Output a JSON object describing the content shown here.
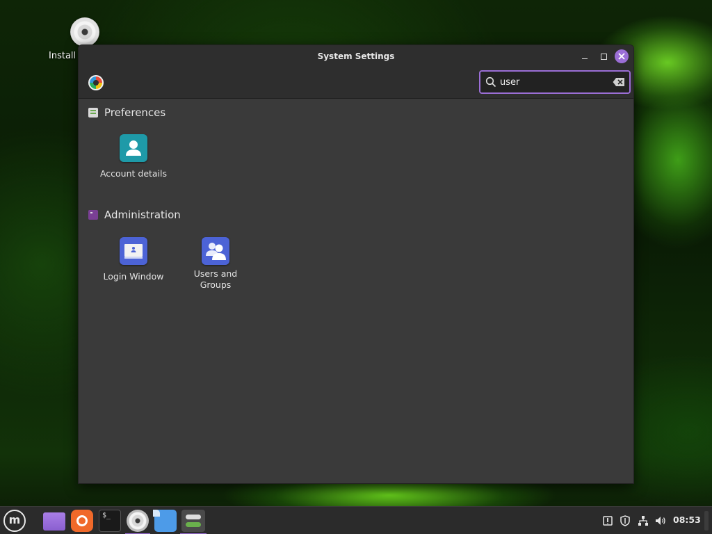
{
  "desktop": {
    "icons": [
      {
        "label": "Install",
        "icon": "disc-icon"
      }
    ]
  },
  "window": {
    "title": "System Settings",
    "controls": [
      "minimize",
      "maximize",
      "close"
    ],
    "accent_color": "#9b6ed6",
    "search": {
      "value": "user",
      "placeholder": ""
    },
    "sections": [
      {
        "title": "Preferences",
        "items": [
          {
            "label": "Account details",
            "icon": "account-icon"
          }
        ]
      },
      {
        "title": "Administration",
        "items": [
          {
            "label": "Login Window",
            "icon": "login-window-icon"
          },
          {
            "label": "Users and Groups",
            "icon": "users-groups-icon"
          }
        ]
      }
    ]
  },
  "taskbar": {
    "launchers": [
      {
        "name": "menu",
        "icon": "mint-logo-icon"
      },
      {
        "name": "files",
        "icon": "folder-icon"
      },
      {
        "name": "firefox",
        "icon": "firefox-icon"
      },
      {
        "name": "terminal",
        "icon": "terminal-icon",
        "glyph": "$_"
      },
      {
        "name": "install",
        "icon": "disc-icon"
      },
      {
        "name": "documents",
        "icon": "document-icon"
      },
      {
        "name": "settings",
        "icon": "settings-icon"
      }
    ],
    "tray": [
      "update-manager-icon",
      "shield-icon",
      "network-icon",
      "volume-icon"
    ],
    "clock": "08:53"
  }
}
